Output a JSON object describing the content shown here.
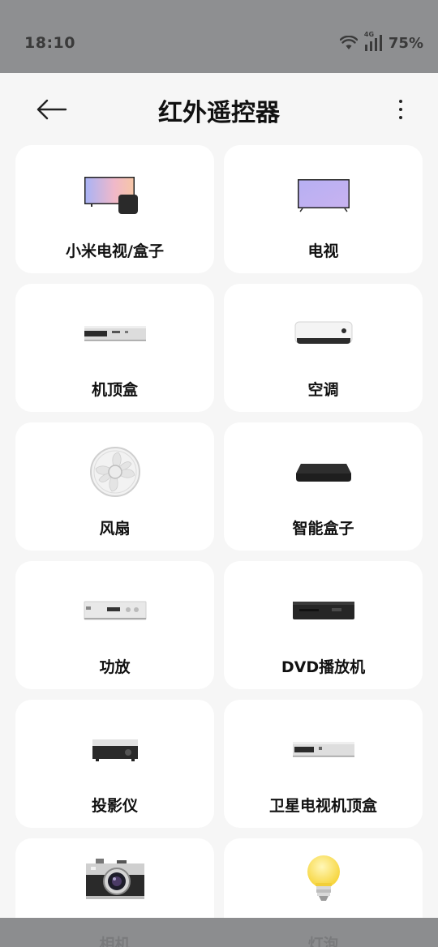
{
  "status": {
    "time": "18:10",
    "network": "4G",
    "battery": "75%"
  },
  "header": {
    "title": "红外遥控器"
  },
  "devices": [
    {
      "label": "小米电视/盒子",
      "icon": "tv-box-icon"
    },
    {
      "label": "电视",
      "icon": "tv-icon"
    },
    {
      "label": "机顶盒",
      "icon": "set-top-box-icon"
    },
    {
      "label": "空调",
      "icon": "air-conditioner-icon"
    },
    {
      "label": "风扇",
      "icon": "fan-icon"
    },
    {
      "label": "智能盒子",
      "icon": "smart-box-icon"
    },
    {
      "label": "功放",
      "icon": "amplifier-icon"
    },
    {
      "label": "DVD播放机",
      "icon": "dvd-player-icon"
    },
    {
      "label": "投影仪",
      "icon": "projector-icon"
    },
    {
      "label": "卫星电视机顶盒",
      "icon": "satellite-box-icon"
    },
    {
      "label": "相机",
      "icon": "camera-icon"
    },
    {
      "label": "灯泡",
      "icon": "light-bulb-icon"
    }
  ]
}
